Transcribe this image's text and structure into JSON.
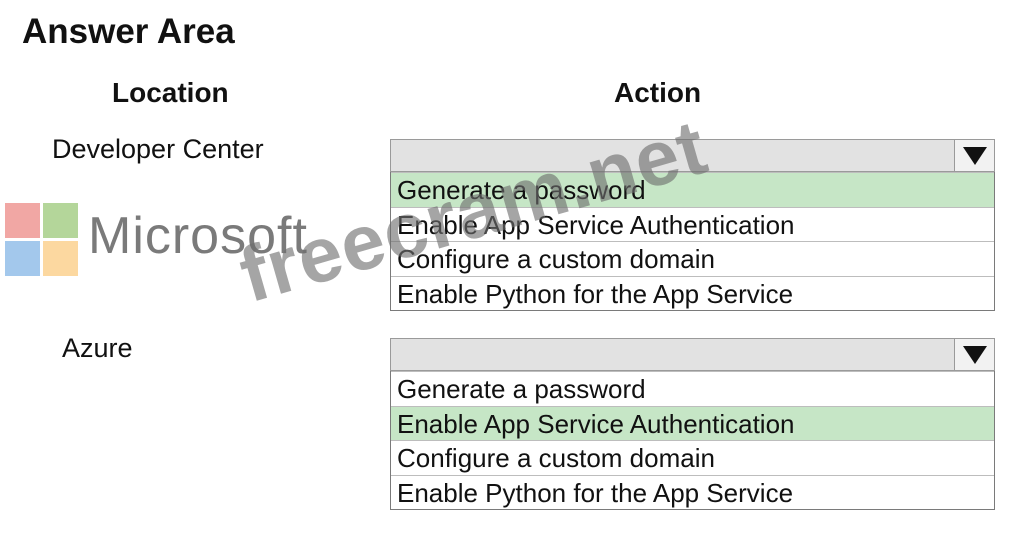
{
  "header": {
    "title": "Answer Area"
  },
  "columns": {
    "location": "Location",
    "action": "Action"
  },
  "rows": [
    {
      "location": "Developer Center",
      "selected_value": "",
      "options": [
        {
          "label": "Generate a password",
          "selected": true
        },
        {
          "label": "Enable App Service Authentication",
          "selected": false
        },
        {
          "label": "Configure a custom domain",
          "selected": false
        },
        {
          "label": "Enable Python for the App Service",
          "selected": false
        }
      ]
    },
    {
      "location": "Azure",
      "selected_value": "",
      "options": [
        {
          "label": "Generate a password",
          "selected": false
        },
        {
          "label": "Enable App Service Authentication",
          "selected": true
        },
        {
          "label": "Configure a custom domain",
          "selected": false
        },
        {
          "label": "Enable Python for the App Service",
          "selected": false
        }
      ]
    }
  ],
  "logo": {
    "text": "Microsoft",
    "colors": [
      "#f1a7a4",
      "#b4d69a",
      "#a3c8ec",
      "#fcd8a0"
    ]
  },
  "watermark": {
    "text": "freecram.net"
  },
  "colors": {
    "selected_bg": "#c6e6c6",
    "dropdown_header_bg": "#e2e2e2"
  }
}
